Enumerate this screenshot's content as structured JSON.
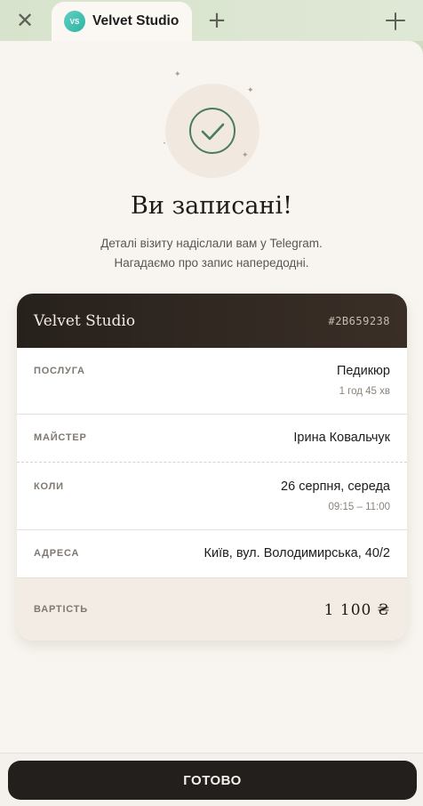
{
  "tabbar": {
    "tab_logo": "VS",
    "tab_title": "Velvet Studio"
  },
  "confirmation": {
    "title": "Ви записані!",
    "subtitle_line1": "Деталі візиту надіслали вам у Telegram.",
    "subtitle_line2": "Нагадаємо про запис напередодні."
  },
  "booking": {
    "brand": "Velvet Studio",
    "code": "#2B659238",
    "service_label": "ПОСЛУГА",
    "service_value": "Педикюр",
    "service_duration": "1 год 45 хв",
    "master_label": "МАЙСТЕР",
    "master_value": "Ірина Ковальчук",
    "when_label": "КОЛИ",
    "when_date": "26 серпня, середа",
    "when_time": "09:15 – 11:00",
    "address_label": "АДРЕСА",
    "address_value": "Київ, вул. Володимирська, 40/2",
    "price_label": "ВАРТІСТЬ",
    "price_value": "1 100 ₴"
  },
  "footer": {
    "done_label": "ГОТОВО"
  },
  "colors": {
    "accent_green": "#4a7a62",
    "card_header": "#2b241f",
    "button": "#231f1c"
  }
}
